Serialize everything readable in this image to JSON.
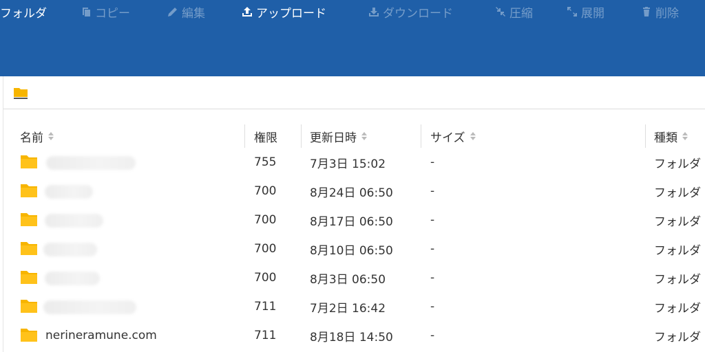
{
  "toolbar": {
    "items": [
      {
        "label": "フォルダ",
        "icon": "",
        "active": true
      },
      {
        "label": "コピー",
        "icon": "copy-icon",
        "active": false
      },
      {
        "label": "編集",
        "icon": "pencil-icon",
        "active": false
      },
      {
        "label": "アップロード",
        "icon": "upload-icon",
        "active": true
      },
      {
        "label": "ダウンロード",
        "icon": "download-icon",
        "active": false
      },
      {
        "label": "圧縮",
        "icon": "compress-icon",
        "active": false
      },
      {
        "label": "展開",
        "icon": "expand-icon",
        "active": false
      },
      {
        "label": "削除",
        "icon": "trash-icon",
        "active": false
      }
    ]
  },
  "table": {
    "headers": {
      "name": "名前",
      "perm": "権限",
      "modified": "更新日時",
      "size": "サイズ",
      "type": "種類"
    },
    "rows": [
      {
        "name": "",
        "perm": "755",
        "modified": "7月3日 15:02",
        "size": "-",
        "type": "フォルダ"
      },
      {
        "name": "",
        "perm": "700",
        "modified": "8月24日 06:50",
        "size": "-",
        "type": "フォルダ"
      },
      {
        "name": "",
        "perm": "700",
        "modified": "8月17日 06:50",
        "size": "-",
        "type": "フォルダ"
      },
      {
        "name": "",
        "perm": "700",
        "modified": "8月10日 06:50",
        "size": "-",
        "type": "フォルダ"
      },
      {
        "name": "",
        "perm": "700",
        "modified": "8月3日 06:50",
        "size": "-",
        "type": "フォルダ"
      },
      {
        "name": "",
        "perm": "711",
        "modified": "7月2日 16:42",
        "size": "-",
        "type": "フォルダ"
      },
      {
        "name": "nerineramune.com",
        "perm": "711",
        "modified": "8月18日 14:50",
        "size": "-",
        "type": "フォルダ"
      }
    ]
  },
  "colors": {
    "toolbar_bg": "#1f5fa8",
    "folder": "#f7b500"
  }
}
